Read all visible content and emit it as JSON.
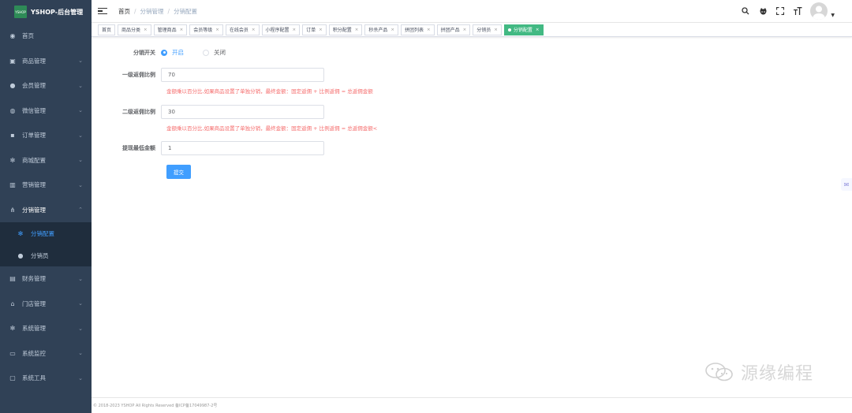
{
  "brand": {
    "logo_text": "YSHOP",
    "title": "YSHOP-后台管理"
  },
  "sidebar": {
    "items": [
      {
        "label": "首页",
        "icon": "dashboard-icon"
      },
      {
        "label": "商品管理",
        "icon": "goods-icon"
      },
      {
        "label": "会员管理",
        "icon": "members-icon"
      },
      {
        "label": "微信管理",
        "icon": "wechat-icon"
      },
      {
        "label": "订单管理",
        "icon": "lock-icon"
      },
      {
        "label": "商城配置",
        "icon": "gear-icon"
      },
      {
        "label": "营销管理",
        "icon": "chart-icon"
      },
      {
        "label": "分销管理",
        "icon": "share-icon"
      },
      {
        "label": "财务管理",
        "icon": "finance-icon"
      },
      {
        "label": "门店管理",
        "icon": "store-icon"
      },
      {
        "label": "系统管理",
        "icon": "system-gear-icon"
      },
      {
        "label": "系统监控",
        "icon": "monitor-icon"
      },
      {
        "label": "系统工具",
        "icon": "tools-icon"
      }
    ],
    "submenu": [
      {
        "label": "分销配置",
        "icon": "gear-icon",
        "active": true
      },
      {
        "label": "分销员",
        "icon": "user-icon",
        "active": false
      }
    ]
  },
  "breadcrumb": [
    "首页",
    "分销管理",
    "分销配置"
  ],
  "tags": [
    {
      "label": "首页",
      "closable": false
    },
    {
      "label": "商品分类",
      "closable": true
    },
    {
      "label": "管理商品",
      "closable": true
    },
    {
      "label": "会员等级",
      "closable": true
    },
    {
      "label": "在线会员",
      "closable": true
    },
    {
      "label": "小程序配置",
      "closable": true
    },
    {
      "label": "订单",
      "closable": true
    },
    {
      "label": "积分配置",
      "closable": true
    },
    {
      "label": "秒杀产品",
      "closable": true
    },
    {
      "label": "拼团列表",
      "closable": true
    },
    {
      "label": "拼团产品",
      "closable": true
    },
    {
      "label": "分销员",
      "closable": true
    },
    {
      "label": "分销配置",
      "closable": true,
      "active": true
    }
  ],
  "form": {
    "switch_label": "分销开关",
    "radio_on": "开启",
    "radio_off": "关闭",
    "level1_label": "一级返佣比例",
    "level1_value": "70",
    "level1_hint": "金额乘以百分比,如果商品设置了单独分销，最终金额：固定返佣 + 比例返佣 = 总返佣金额",
    "level2_label": "二级返佣比例",
    "level2_value": "30",
    "level2_hint": "金额乘以百分比,如果商品设置了单独分销，最终金额：固定返佣 + 比例返佣 = 总返佣金额<",
    "min_withdraw_label": "提现最低金额",
    "min_withdraw_value": "1",
    "submit_label": "提交"
  },
  "footer": {
    "text": "© 2018-2023 YSHOP All Rights Reserved   备ICP备17049987-2号"
  },
  "watermark": {
    "text": "源缘编程"
  },
  "colors": {
    "sidebar_bg": "#304156",
    "primary": "#409eff",
    "tag_active": "#42b983",
    "hint": "#f56c6c"
  }
}
